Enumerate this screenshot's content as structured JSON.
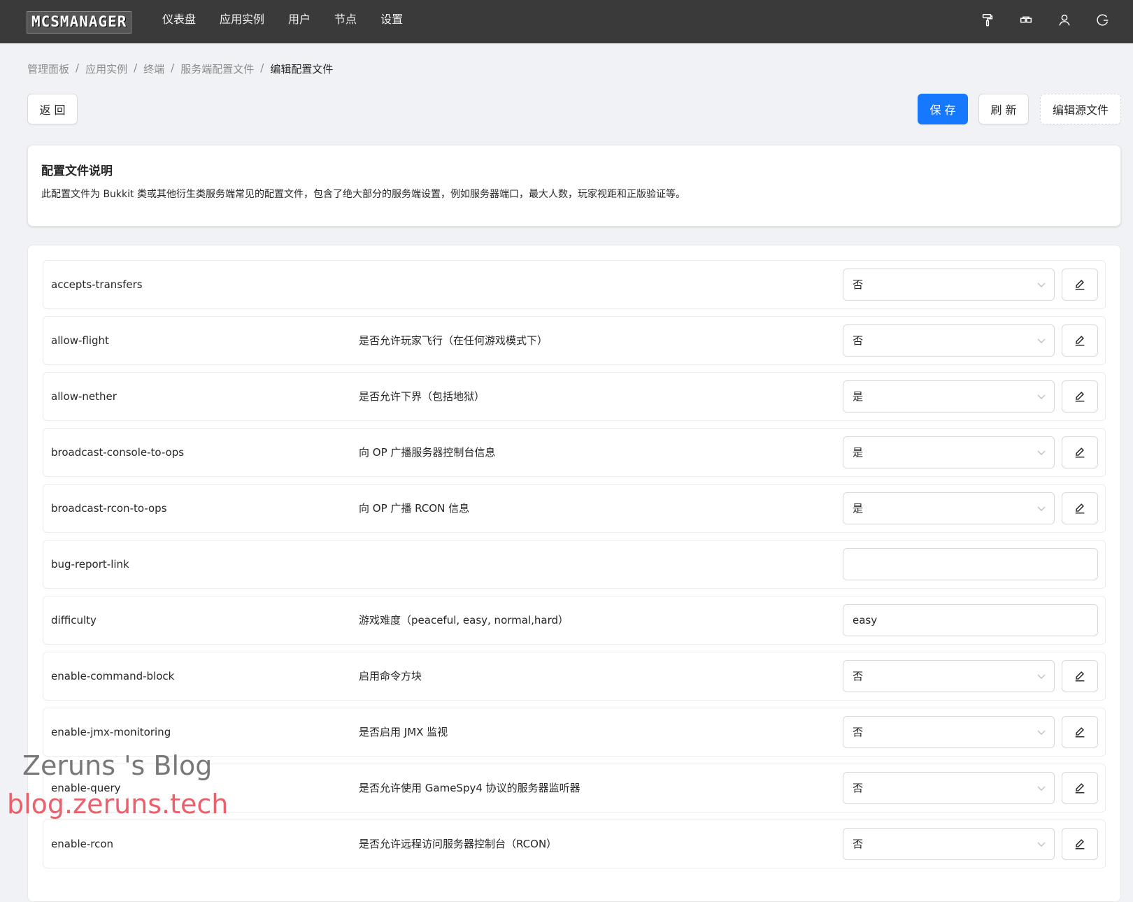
{
  "topbar": {
    "logo": "MCSMANAGER",
    "nav": [
      "仪表盘",
      "应用实例",
      "用户",
      "节点",
      "设置"
    ],
    "icons": [
      "paint-roller-icon",
      "layout-icon",
      "user-icon",
      "logout-icon"
    ]
  },
  "breadcrumb": [
    "管理面板",
    "应用实例",
    "终端",
    "服务端配置文件",
    "编辑配置文件"
  ],
  "breadcrumb_separator": "/",
  "actions": {
    "back": "返 回",
    "save": "保 存",
    "refresh": "刷 新",
    "edit_source": "编辑源文件"
  },
  "info": {
    "title": "配置文件说明",
    "description": "此配置文件为 Bukkit 类或其他衍生类服务端常见的配置文件，包含了绝大部分的服务端设置，例如服务器端口，最大人数，玩家视距和正版验证等。"
  },
  "colors": {
    "primary": "#1677ff",
    "topbar": "#3a3a3a"
  },
  "rows": [
    {
      "key": "accepts-transfers",
      "desc": "",
      "type": "select",
      "value": "否"
    },
    {
      "key": "allow-flight",
      "desc": "是否允许玩家飞行（在任何游戏模式下）",
      "type": "select",
      "value": "否"
    },
    {
      "key": "allow-nether",
      "desc": "是否允许下界（包括地狱）",
      "type": "select",
      "value": "是"
    },
    {
      "key": "broadcast-console-to-ops",
      "desc": "向 OP 广播服务器控制台信息",
      "type": "select",
      "value": "是"
    },
    {
      "key": "broadcast-rcon-to-ops",
      "desc": "向 OP 广播 RCON 信息",
      "type": "select",
      "value": "是"
    },
    {
      "key": "bug-report-link",
      "desc": "",
      "type": "input",
      "value": ""
    },
    {
      "key": "difficulty",
      "desc": "游戏难度（peaceful, easy, normal,hard）",
      "type": "input",
      "value": "easy"
    },
    {
      "key": "enable-command-block",
      "desc": "启用命令方块",
      "type": "select",
      "value": "否"
    },
    {
      "key": "enable-jmx-monitoring",
      "desc": "是否启用 JMX 监视",
      "type": "select",
      "value": "否"
    },
    {
      "key": "enable-query",
      "desc": "是否允许使用 GameSpy4 协议的服务器监听器",
      "type": "select",
      "value": "否"
    },
    {
      "key": "enable-rcon",
      "desc": "是否允许远程访问服务器控制台（RCON）",
      "type": "select",
      "value": "否"
    }
  ],
  "watermark": {
    "line1": "Zeruns 's Blog",
    "line2": "blog.zeruns.tech"
  }
}
